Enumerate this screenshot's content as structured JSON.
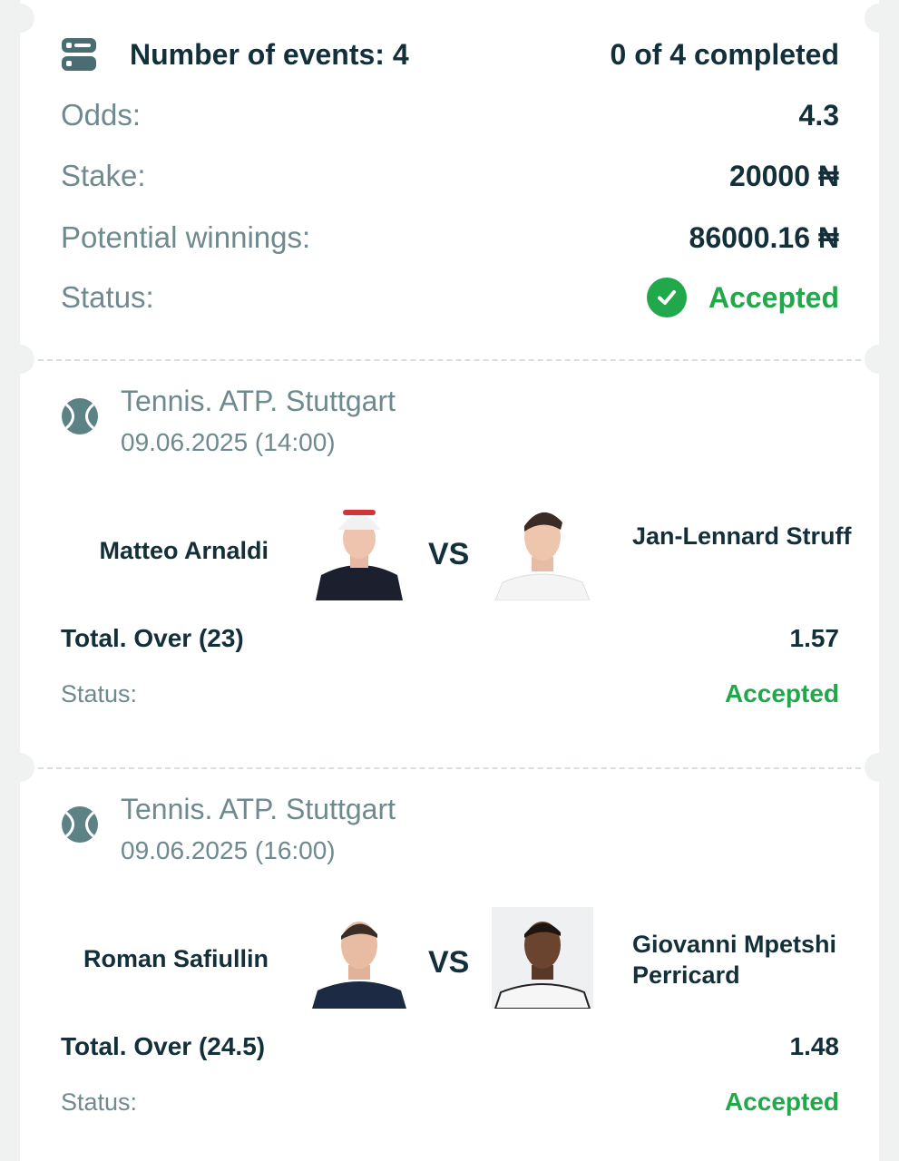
{
  "summary": {
    "events_label": "Number of events: 4",
    "completed": "0 of 4 completed",
    "odds_label": "Odds:",
    "odds_value": "4.3",
    "stake_label": "Stake:",
    "stake_value": "20000 ₦",
    "winnings_label": "Potential winnings:",
    "winnings_value": "86000.16 ₦",
    "status_label": "Status:",
    "status_value": "Accepted",
    "icon": "events-list-icon"
  },
  "events": [
    {
      "league": "Tennis. ATP. Stuttgart",
      "datetime": "09.06.2025 (14:00)",
      "player1": "Matteo Arnaldi",
      "player2": "Jan-Lennard Struff",
      "vs": "VS",
      "market": "Total. Over (23)",
      "odd": "1.57",
      "status_label": "Status:",
      "status_value": "Accepted"
    },
    {
      "league": "Tennis. ATP. Stuttgart",
      "datetime": "09.06.2025 (16:00)",
      "player1": "Roman Safiullin",
      "player2": "Giovanni Mpetshi Perricard",
      "vs": "VS",
      "market": "Total. Over (24.5)",
      "odd": "1.48",
      "status_label": "Status:",
      "status_value": "Accepted"
    }
  ],
  "colors": {
    "accent_green": "#21a84a",
    "text_dark": "#13303a",
    "text_muted": "#6e8a8f",
    "background": "#f0f2f2"
  }
}
